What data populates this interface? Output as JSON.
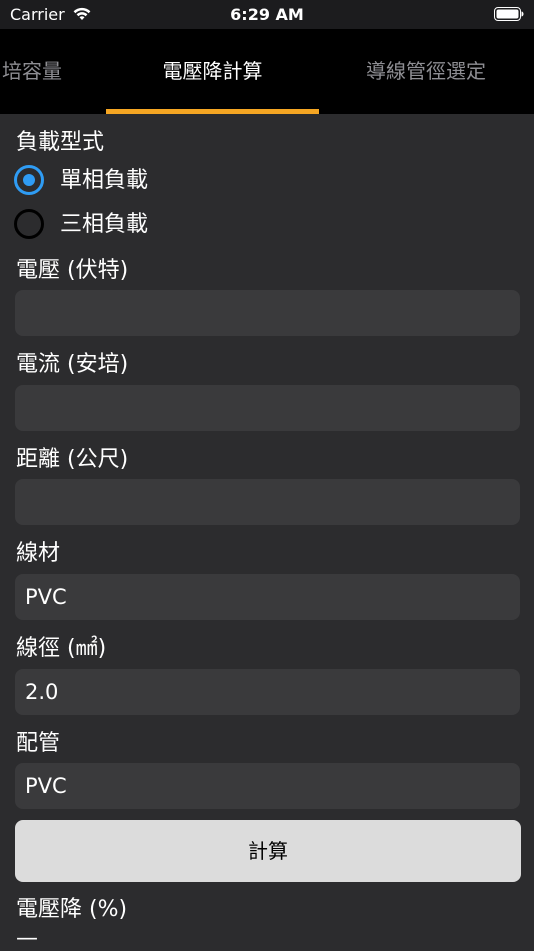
{
  "status_bar": {
    "carrier": "Carrier",
    "time": "6:29 AM"
  },
  "tabs": [
    {
      "label": "培容量",
      "active": false
    },
    {
      "label": "電壓降計算",
      "active": true
    },
    {
      "label": "導線管徑選定",
      "active": false
    }
  ],
  "colors": {
    "accent": "#f5a623",
    "radio_selected": "#2f9cf4",
    "background": "#2c2c2e",
    "field_bg": "#3a3a3c",
    "button_bg": "#dcdcdc"
  },
  "form": {
    "load_type_label": "負載型式",
    "load_options": [
      {
        "label": "單相負載",
        "selected": true
      },
      {
        "label": "三相負載",
        "selected": false
      }
    ],
    "voltage_label": "電壓 (伏特)",
    "voltage_value": "",
    "current_label": "電流 (安培)",
    "current_value": "",
    "distance_label": "距離 (公尺)",
    "distance_value": "",
    "wire_material_label": "線材",
    "wire_material_value": "PVC",
    "wire_size_label": "線徑 (㎟)",
    "wire_size_value": "2.0",
    "conduit_label": "配管",
    "conduit_value": "PVC",
    "calculate_button": "計算",
    "result_label": "電壓降 (%)",
    "result_value": "—"
  }
}
